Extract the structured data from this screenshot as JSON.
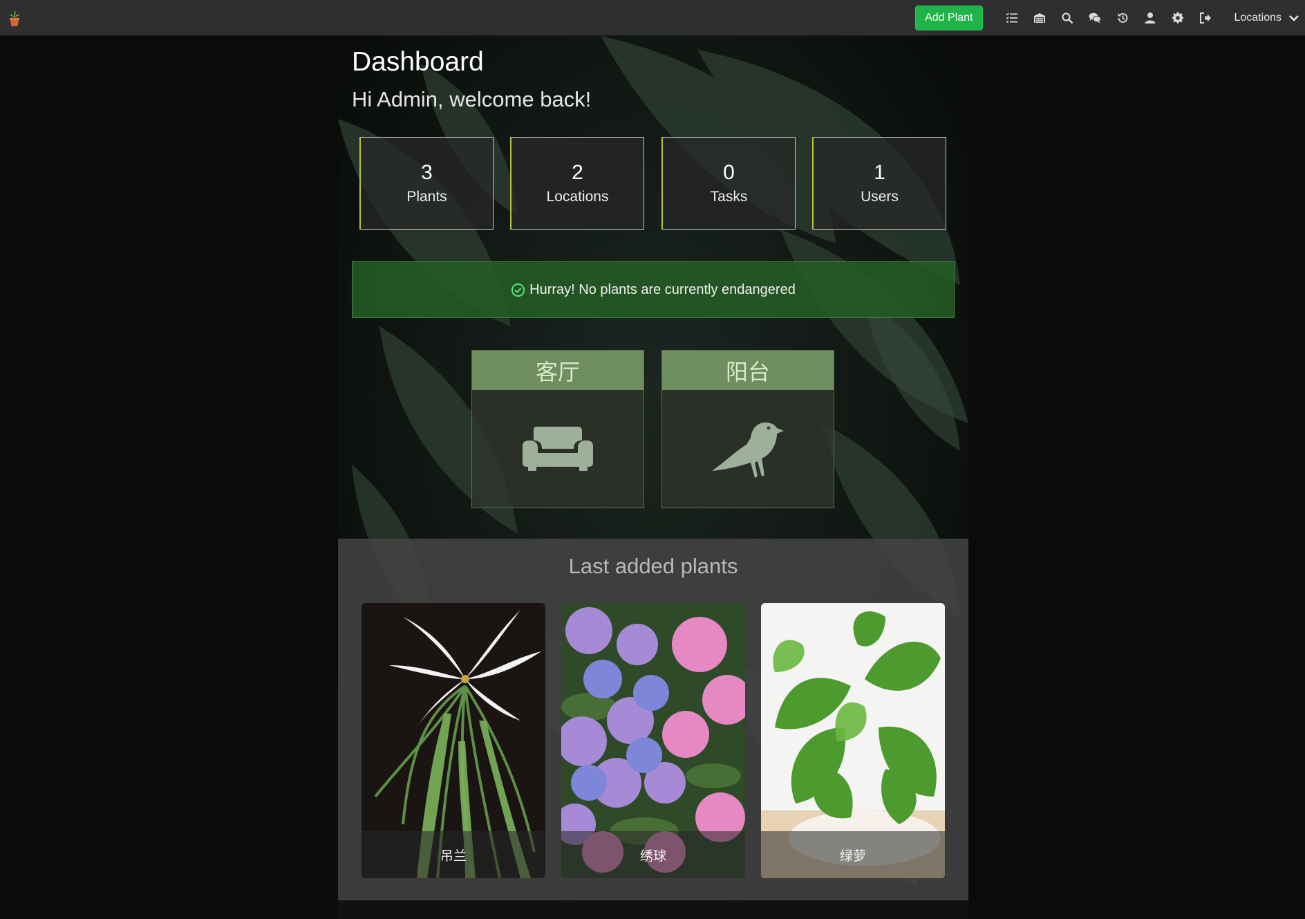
{
  "navbar": {
    "logo": "potted-plant-icon",
    "add_plant_label": "Add Plant",
    "icons": [
      "tasks-icon",
      "inventory-icon",
      "search-icon",
      "chat-icon",
      "history-icon",
      "user-icon",
      "settings-icon",
      "logout-icon"
    ],
    "locations_label": "Locations"
  },
  "page": {
    "title": "Dashboard",
    "welcome": "Hi Admin, welcome back!"
  },
  "stats": [
    {
      "value": "3",
      "label": "Plants"
    },
    {
      "value": "2",
      "label": "Locations"
    },
    {
      "value": "0",
      "label": "Tasks"
    },
    {
      "value": "1",
      "label": "Users"
    }
  ],
  "alert": {
    "icon": "check-circle-icon",
    "text": "Hurray! No plants are currently endangered"
  },
  "locations": [
    {
      "name": "客厅",
      "icon": "couch-icon"
    },
    {
      "name": "阳台",
      "icon": "crow-icon"
    }
  ],
  "recent": {
    "title": "Last added plants",
    "plants": [
      {
        "name": "吊兰"
      },
      {
        "name": "绣球"
      },
      {
        "name": "绿萝"
      }
    ]
  },
  "colors": {
    "accent_green": "#1fb34a",
    "stat_border_accent": "#b7c43c",
    "alert_bg": "#245c26",
    "location_header": "#6f8e60"
  }
}
